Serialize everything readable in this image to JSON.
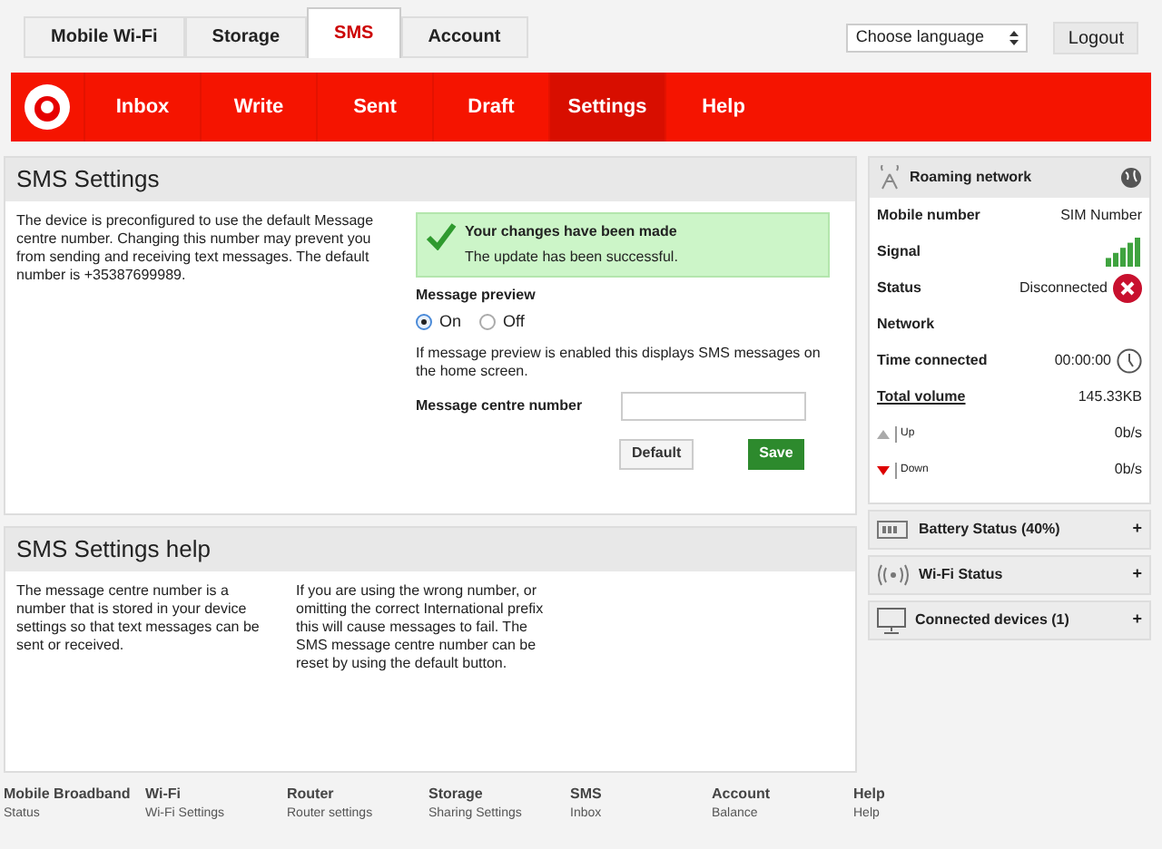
{
  "top_tabs": [
    {
      "label": "Mobile Wi-Fi",
      "selected": false
    },
    {
      "label": "Storage",
      "selected": false
    },
    {
      "label": "SMS",
      "selected": true
    },
    {
      "label": "Account",
      "selected": false
    }
  ],
  "language_select": {
    "value": "Choose language"
  },
  "logout_button": "Logout",
  "nav": [
    {
      "label": "Inbox",
      "selected": false
    },
    {
      "label": "Write",
      "selected": false
    },
    {
      "label": "Sent",
      "selected": false
    },
    {
      "label": "Draft",
      "selected": false
    },
    {
      "label": "Settings",
      "selected": true
    },
    {
      "label": "Help",
      "selected": false
    }
  ],
  "settings": {
    "title": "SMS Settings",
    "description": "The device is preconfigured to use the default Message centre number. Changing this number may prevent you from sending and receiving text messages. The default number is +35387699989.",
    "alert": {
      "title": "Your changes have been made",
      "message": "The update has been successful."
    },
    "preview": {
      "label": "Message preview",
      "options": [
        {
          "label": "On",
          "selected": true
        },
        {
          "label": "Off",
          "selected": false
        }
      ],
      "note": "If message preview is enabled this displays SMS messages on the home screen."
    },
    "centre_number": {
      "label": "Message centre number"
    },
    "buttons": [
      {
        "label": "Default",
        "kind": "secondary"
      },
      {
        "label": "Save",
        "kind": "primary"
      }
    ]
  },
  "help": {
    "title": "SMS Settings help",
    "paragraphs": [
      "The message centre number is a number that is stored in your device settings so that text messages can be sent or received.",
      "If you are using the wrong number, or omitting the correct International prefix this will cause messages to fail. The SMS message centre number can be reset by using the default button."
    ]
  },
  "sidebar": {
    "title": "Roaming network",
    "rows": [
      {
        "kind": "text",
        "label": "Mobile number",
        "value": "SIM Number"
      },
      {
        "kind": "signal",
        "label": "Signal"
      },
      {
        "kind": "status",
        "label": "Status",
        "value": "Disconnected"
      },
      {
        "kind": "text",
        "label": "Network"
      },
      {
        "kind": "time",
        "label": "Time connected",
        "value": "00:00:00"
      },
      {
        "kind": "link",
        "label": "Total volume",
        "value": "145.33KB"
      },
      {
        "kind": "up",
        "label": "Up",
        "value": "0b/s"
      },
      {
        "kind": "down",
        "label": "Down",
        "value": "0b/s"
      }
    ],
    "sections": [
      {
        "kind": "battery",
        "title": "Battery Status (40%)",
        "toggle": "+"
      },
      {
        "kind": "wifi",
        "title": "Wi-Fi Status",
        "toggle": "+"
      },
      {
        "kind": "devices",
        "title": "Connected devices (1)",
        "toggle": "+"
      }
    ]
  },
  "footer": [
    {
      "title": "Mobile Broadband",
      "link": "Status"
    },
    {
      "title": "Wi-Fi",
      "link": "Wi-Fi Settings"
    },
    {
      "title": "Router",
      "link": "Router settings"
    },
    {
      "title": "Storage",
      "link": "Sharing Settings"
    },
    {
      "title": "SMS",
      "link": "Inbox"
    },
    {
      "title": "Account",
      "link": "Balance"
    },
    {
      "title": "Help",
      "link": "Help"
    }
  ]
}
